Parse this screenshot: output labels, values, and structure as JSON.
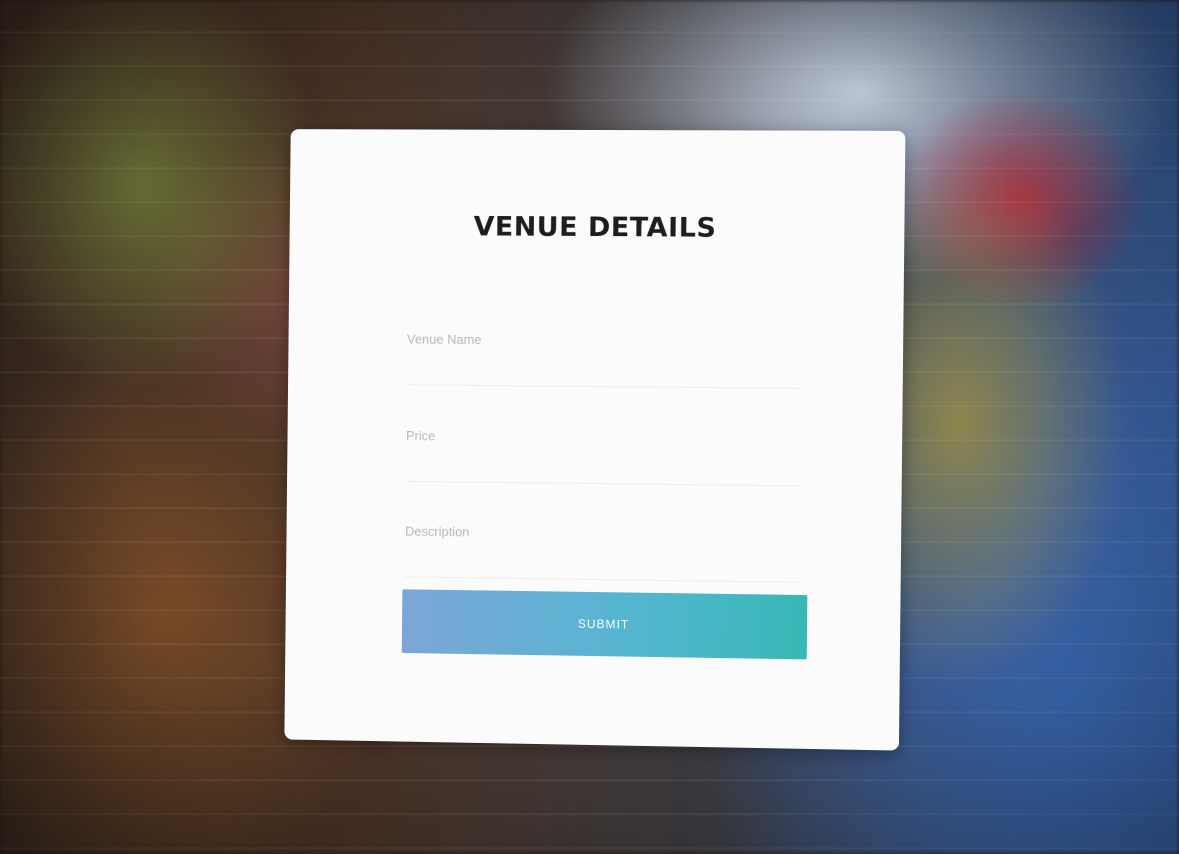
{
  "form": {
    "title": "VENUE DETAILS",
    "fields": [
      {
        "label": "Venue Name",
        "value": ""
      },
      {
        "label": "Price",
        "value": ""
      },
      {
        "label": "Description",
        "value": ""
      }
    ],
    "submit_label": "SUBMIT"
  },
  "colors": {
    "card_background": "#fbfbfb",
    "title_text": "#1d1d1d",
    "label_text": "#b8b8b8",
    "button_gradient_start": "#7da6d6",
    "button_gradient_end": "#38b8b6"
  }
}
